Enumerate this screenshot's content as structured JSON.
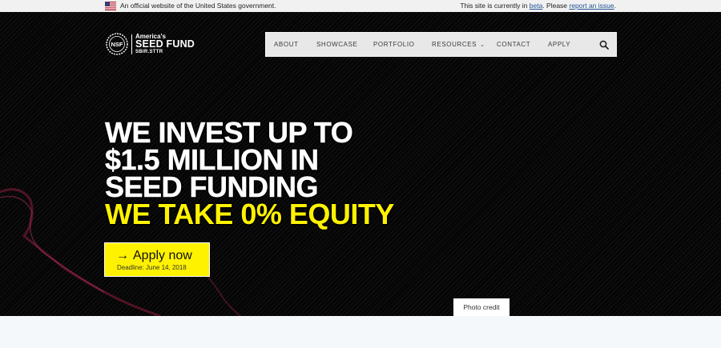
{
  "gov_banner": {
    "flag_icon": "us-flag-icon",
    "official_text": "An official website of the United States government.",
    "beta_prefix": "This site is currently in ",
    "beta_link": "beta",
    "beta_middle": ". Please ",
    "report_link": "report an issue",
    "beta_suffix": "."
  },
  "logo": {
    "seal_text": "NSF",
    "line1": "America's",
    "line2": "SEED FUND",
    "line3": "SBIR.STTR"
  },
  "nav": {
    "items": [
      {
        "label": "About"
      },
      {
        "label": "Showcase"
      },
      {
        "label": "Portfolio"
      },
      {
        "label": "Resources",
        "has_dropdown": true
      },
      {
        "label": "Contact"
      },
      {
        "label": "Apply"
      }
    ],
    "search_icon": "search-icon"
  },
  "hero": {
    "line1": "WE INVEST UP TO",
    "line2": "$1.5 MILLION IN",
    "line3": "SEED FUNDING",
    "line4": "WE TAKE 0% EQUITY",
    "cta": {
      "arrow": "→",
      "label": "Apply now",
      "deadline": "Deadline: June 14, 2018"
    },
    "photo_credit": "Photo credit"
  },
  "colors": {
    "accent_yellow": "#fff200",
    "hero_bg": "#050505",
    "link_blue": "#205493"
  }
}
